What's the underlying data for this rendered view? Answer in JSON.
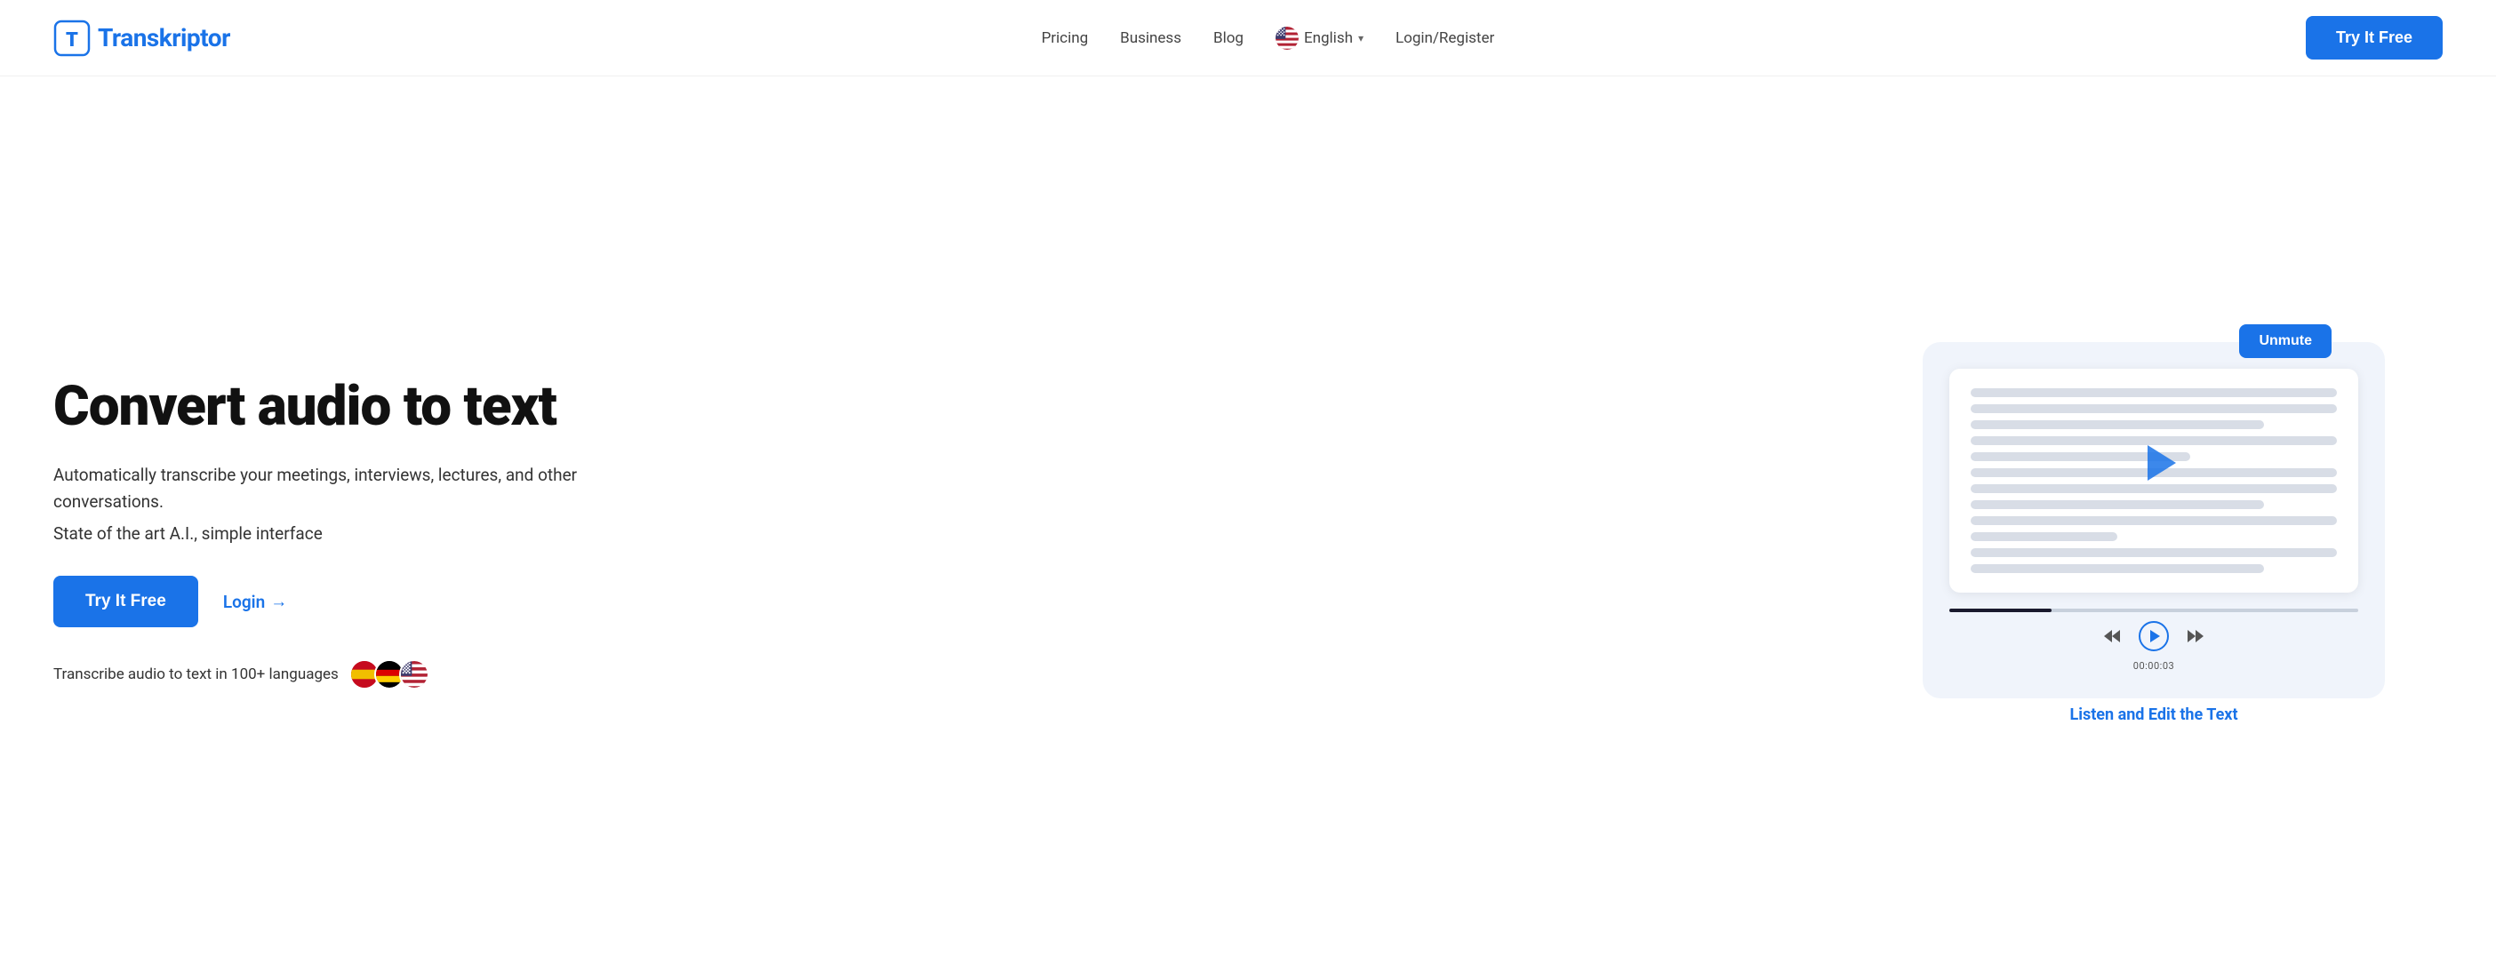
{
  "header": {
    "logo_text_prefix": "T",
    "logo_text_rest": "ranskriptor",
    "nav": {
      "pricing": "Pricing",
      "business": "Business",
      "blog": "Blog",
      "language": "English",
      "login_register": "Login/Register"
    },
    "try_btn": "Try It Free"
  },
  "hero": {
    "title": "Convert audio to text",
    "subtitle1": "Automatically transcribe your meetings, interviews, lectures, and other conversations.",
    "subtitle2": "State of the art A.I., simple interface",
    "try_btn": "Try It Free",
    "login_label": "Login",
    "login_arrow": "→",
    "languages_label": "Transcribe audio to text in 100+ languages",
    "flags": [
      "🇪🇸",
      "🇩🇪",
      "🇺🇸"
    ]
  },
  "player": {
    "unmute_btn": "Unmute",
    "listen_edit": "Listen and Edit the Text",
    "timestamp": "00:00:03"
  }
}
